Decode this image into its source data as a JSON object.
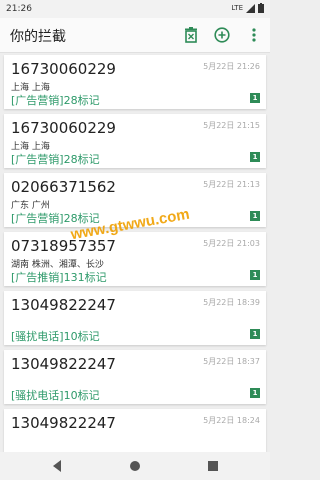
{
  "status": {
    "time": "21:26",
    "network": "LTE"
  },
  "toolbar": {
    "title": "你的拦截",
    "icons": [
      "delete-icon",
      "add-circle-icon",
      "more-vert-icon"
    ]
  },
  "list": [
    {
      "phone": "16730060229",
      "location": "上海 上海",
      "tag": "[广告营销]28标记",
      "date": "5月22日 21:26",
      "badge": "1"
    },
    {
      "phone": "16730060229",
      "location": "上海 上海",
      "tag": "[广告营销]28标记",
      "date": "5月22日 21:15",
      "badge": "1"
    },
    {
      "phone": "02066371562",
      "location": "广东 广州",
      "tag": "[广告营销]28标记",
      "date": "5月22日 21:13",
      "badge": "1"
    },
    {
      "phone": "07318957357",
      "location": "湖南 株洲、湘潭、长沙",
      "tag": "[广告推销]131标记",
      "date": "5月22日 21:03",
      "badge": "1"
    },
    {
      "phone": "13049822247",
      "location": "",
      "tag": "[骚扰电话]10标记",
      "date": "5月22日 18:39",
      "badge": "1"
    },
    {
      "phone": "13049822247",
      "location": "",
      "tag": "[骚扰电话]10标记",
      "date": "5月22日 18:37",
      "badge": "1"
    },
    {
      "phone": "13049822247",
      "location": "",
      "tag": "",
      "date": "5月22日 18:24",
      "badge": ""
    }
  ],
  "watermark": "www.gtwwu.com",
  "colors": {
    "tag": "#2e9a6a",
    "badge": "#2e8b57",
    "accent": "#2e8b57"
  }
}
